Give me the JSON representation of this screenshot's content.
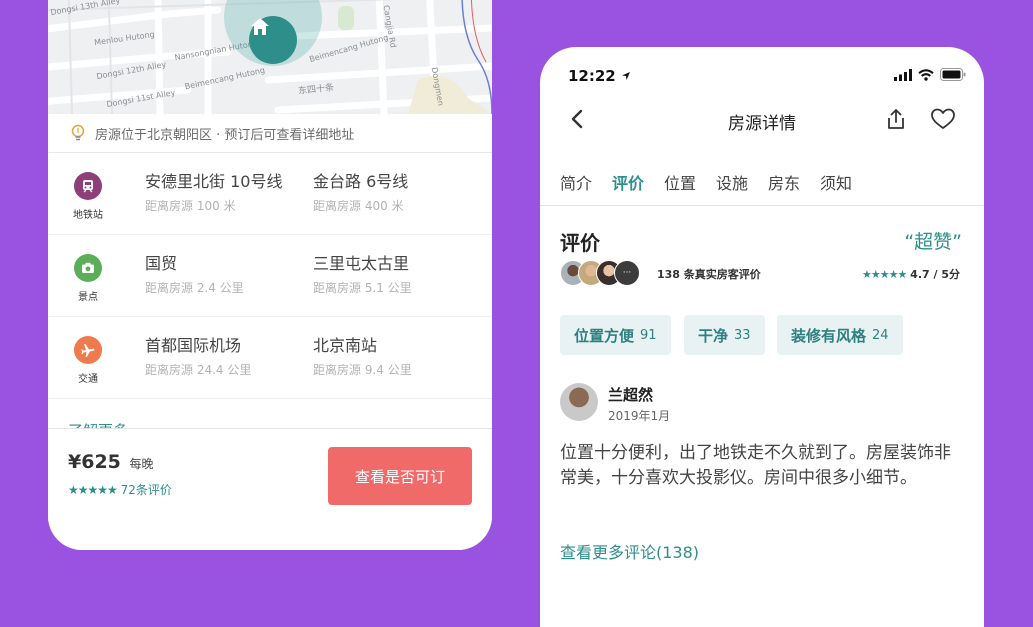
{
  "colors": {
    "background": "#9a52e0",
    "accent": "#2e8f8a",
    "cta": "#f06a6a"
  },
  "map": {
    "labels": [
      "Dongsi 13th Alley",
      "Menlou Hutong",
      "Dongsi 12th Alley",
      "Dongsi 11st Alley",
      "Nansongnian Hutong",
      "Beimencang Hutong",
      "Beimencang Hutong",
      "Cangjia Rd",
      "东四十条",
      "Dongmen"
    ],
    "pin_icon": "home-icon"
  },
  "address": {
    "icon": "lightbulb-icon",
    "text": "房源位于北京朝阳区 · 预订后可查看详细地址"
  },
  "poi_groups": [
    {
      "category": "地铁站",
      "icon": "subway-icon",
      "color": "#8e3f7a",
      "places": [
        {
          "name": "安德里北街 10号线",
          "distance": "距离房源 100 米"
        },
        {
          "name": "金台路 6号线",
          "distance": "距离房源 400 米"
        }
      ]
    },
    {
      "category": "景点",
      "icon": "camera-icon",
      "color": "#5aae58",
      "places": [
        {
          "name": "国贸",
          "distance": "距离房源 2.4 公里"
        },
        {
          "name": "三里屯太古里",
          "distance": "距离房源 5.1 公里"
        }
      ]
    },
    {
      "category": "交通",
      "icon": "airplane-icon",
      "color": "#ef7a4e",
      "places": [
        {
          "name": "首都国际机场",
          "distance": "距离房源 24.4 公里"
        },
        {
          "name": "北京南站",
          "distance": "距离房源 9.4 公里"
        }
      ]
    }
  ],
  "more_link": "了解更多",
  "booking": {
    "price": "¥625",
    "per": "每晚",
    "stars": "★★★★★",
    "review_count": "72条评价",
    "cta": "查看是否可订"
  },
  "phone": {
    "status": {
      "time": "12:22"
    },
    "nav": {
      "title": "房源详情"
    },
    "tabs": [
      "简介",
      "评价",
      "位置",
      "设施",
      "房东",
      "须知"
    ],
    "active_tab": "评价",
    "reviews": {
      "title": "评价",
      "badge": "“超赞”",
      "count_text": "138 条真实房客评价",
      "stars": "★★★★★",
      "score": "4.7 / 5分",
      "more_avatar": "···",
      "tags": [
        {
          "label": "位置方便",
          "count": "91"
        },
        {
          "label": "干净",
          "count": "33"
        },
        {
          "label": "装修有风格",
          "count": "24"
        }
      ],
      "first": {
        "name": "兰超然",
        "date": "2019年1月",
        "text": "位置十分便利，出了地铁走不久就到了。房屋装饰非常美，十分喜欢大投影仪。房间中很多小细节。"
      },
      "more": "查看更多评论(138)"
    }
  }
}
